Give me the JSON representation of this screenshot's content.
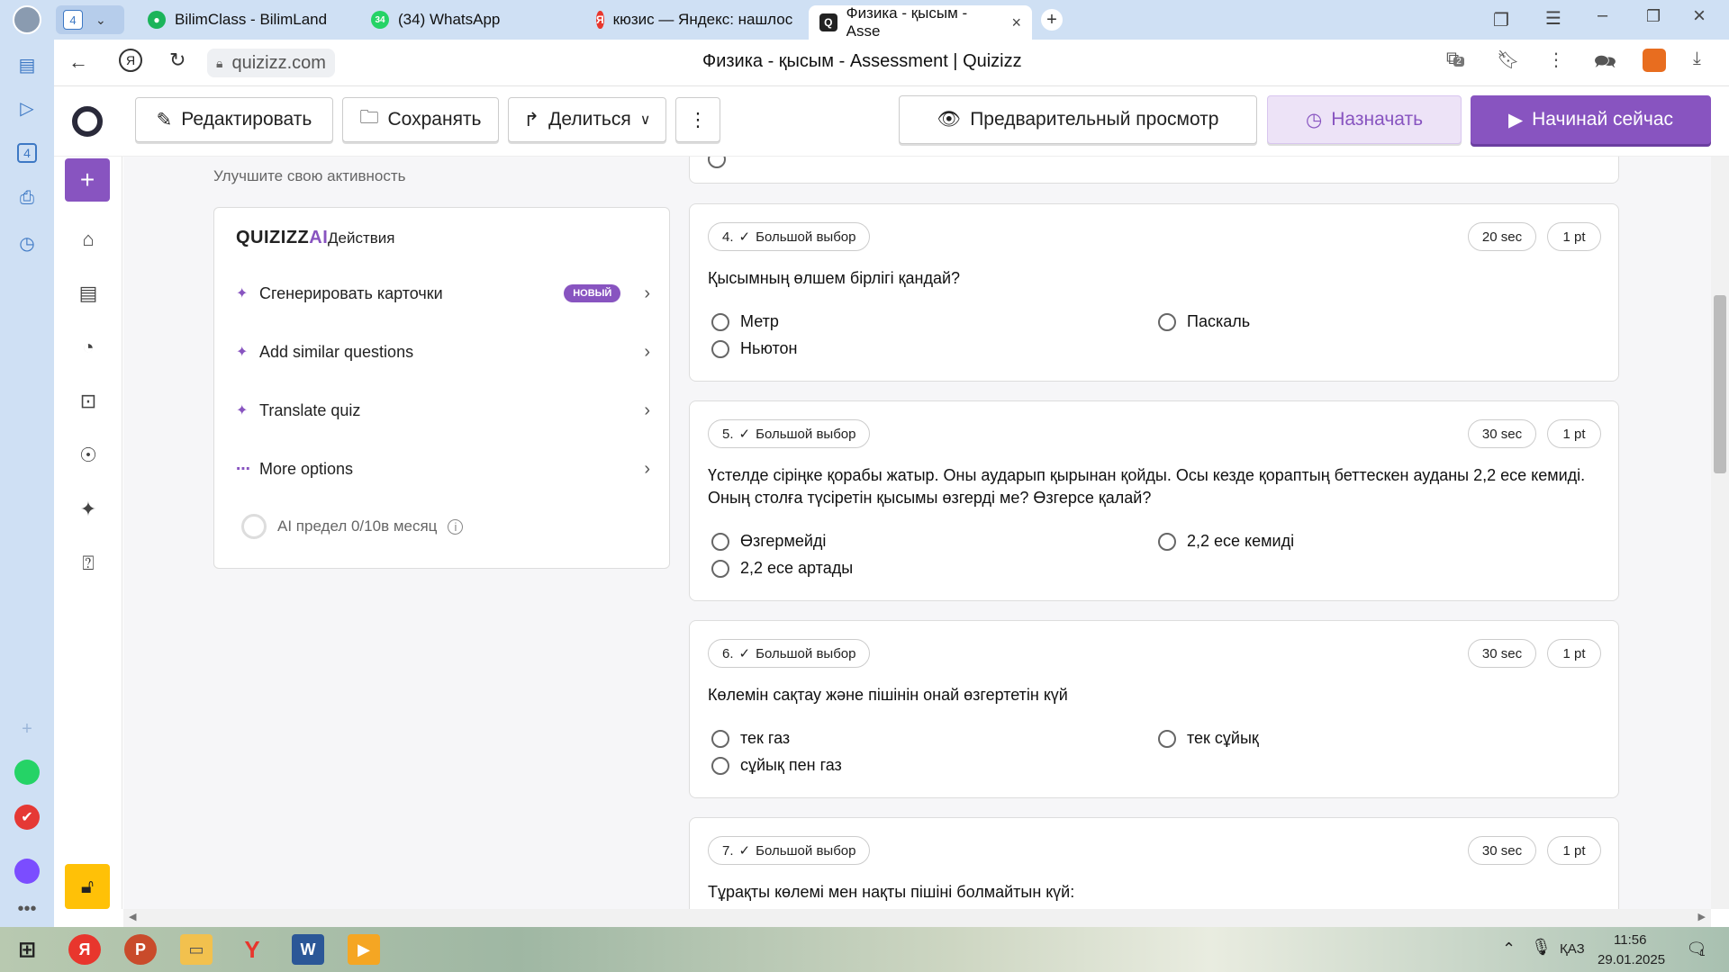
{
  "browser": {
    "tab_count": "4",
    "tabs": [
      {
        "label": "BilimClass - BilimLand"
      },
      {
        "label": "(34) WhatsApp",
        "badge": "34"
      },
      {
        "label": "кюзис — Яндекс: нашлос"
      },
      {
        "label": "Физика - қысым - Asse"
      }
    ],
    "address": "quizizz.com",
    "page_title": "Физика - қысым - Assessment | Quizizz",
    "extension_badge": "2",
    "side_counter": "4"
  },
  "toolbar": {
    "edit": "Редактировать",
    "save": "Сохранять",
    "share": "Делиться",
    "preview": "Предварительный просмотр",
    "assign": "Назначать",
    "start": "Начинай сейчас"
  },
  "activity": {
    "heading": "Улучшите свою активность",
    "brand": "QUIZIZZ",
    "brand_ai": "AI",
    "panel_title": "Действия",
    "items": [
      {
        "label": "Сгенерировать карточки",
        "badge": "НОВЫЙ"
      },
      {
        "label": "Add similar questions"
      },
      {
        "label": "Translate quiz"
      },
      {
        "label": "More options"
      }
    ],
    "limit": "AI предел 0/10в месяц"
  },
  "questions": [
    {
      "num": "4.",
      "type": "Большой выбор",
      "time": "20 sec",
      "points": "1 pt",
      "text": "Қысымның өлшем бірлігі қандай?",
      "options": [
        "Метр",
        "Паскаль",
        "Ньютон"
      ]
    },
    {
      "num": "5.",
      "type": "Большой выбор",
      "time": "30 sec",
      "points": "1 pt",
      "text": "Үстелде сіріңке қорабы жатыр. Оны аударып қырынан қойды. Осы кезде қораптың беттескен ауданы 2,2 есе кемиді. Оның столға түсіретін қысымы өзгерді ме? Өзгерсе қалай?",
      "options": [
        "Өзгермейді",
        "2,2 есе кемиді",
        "2,2 есе артады"
      ]
    },
    {
      "num": "6.",
      "type": "Большой выбор",
      "time": "30 sec",
      "points": "1 pt",
      "text": "Көлемін сақтау және пішінін онай өзгертетін күй",
      "options": [
        "тек газ",
        "тек сұйық",
        "сұйық пен газ"
      ]
    },
    {
      "num": "7.",
      "type": "Большой выбор",
      "time": "30 sec",
      "points": "1 pt",
      "text": "Тұрақты көлемі мен нақты пішіні болмайтын күй:"
    }
  ],
  "taskbar": {
    "lang": "ҚАЗ",
    "time": "11:56",
    "date": "29.01.2025",
    "notifications": "1"
  },
  "colors": {
    "accent": "#8854c0",
    "assign_bg": "#ede3f7",
    "tab_strip": "#cfe0f4"
  }
}
